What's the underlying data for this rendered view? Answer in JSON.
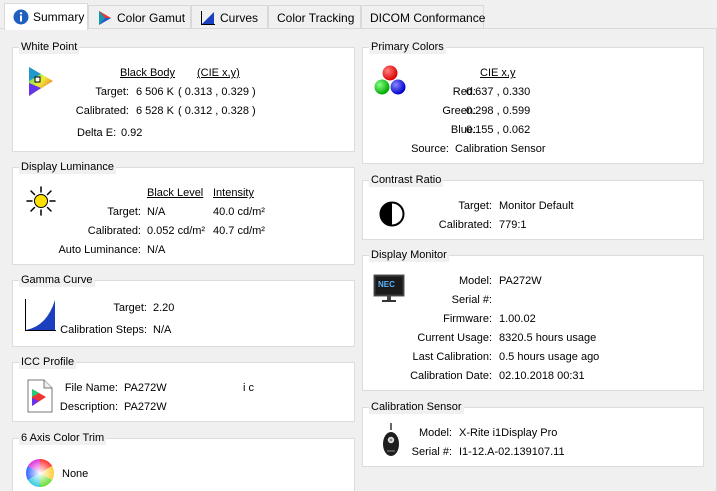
{
  "tabs": [
    {
      "label": "Summary",
      "icon": "info-icon",
      "active": true
    },
    {
      "label": "Color Gamut",
      "icon": "gamut-icon",
      "active": false
    },
    {
      "label": "Curves",
      "icon": "curves-icon",
      "active": false
    },
    {
      "label": "Color Tracking",
      "icon": "",
      "active": false
    },
    {
      "label": "DICOM Conformance",
      "icon": "",
      "active": false
    }
  ],
  "white_point": {
    "title": "White Point",
    "col_black_body": "Black Body",
    "col_cie": "(CIE x,y)",
    "target_label": "Target:",
    "target_value": "6 506 K",
    "target_cie": "( 0.313 , 0.329 )",
    "calibrated_label": "Calibrated:",
    "calibrated_value": "6 528 K",
    "calibrated_cie": "( 0.312 , 0.328 )",
    "delta_label": "Delta E:",
    "delta_value": "0.92"
  },
  "display_luminance": {
    "title": "Display Luminance",
    "col_black": "Black Level",
    "col_intensity": "Intensity",
    "target_label": "Target:",
    "target_black": "N/A",
    "target_intensity": "40.0 cd/m²",
    "calibrated_label": "Calibrated:",
    "calibrated_black": "0.052 cd/m²",
    "calibrated_intensity": "40.7 cd/m²",
    "auto_label": "Auto Luminance:",
    "auto_value": "N/A"
  },
  "gamma_curve": {
    "title": "Gamma Curve",
    "target_label": "Target:",
    "target_value": "2.20",
    "steps_label": "Calibration Steps:",
    "steps_value": "N/A"
  },
  "icc_profile": {
    "title": "ICC Profile",
    "file_label": "File Name:",
    "file_value": "PA272W",
    "file_value_tail": "i c",
    "desc_label": "Description:",
    "desc_value": "PA272W"
  },
  "six_axis": {
    "title": "6 Axis Color Trim",
    "value": "None"
  },
  "primary_colors": {
    "title": "Primary Colors",
    "col_cie": "CIE x,y",
    "red_label": "Red:",
    "red_value": "0.637 , 0.330",
    "green_label": "Green:",
    "green_value": "0.298 , 0.599",
    "blue_label": "Blue:",
    "blue_value": "0.155 , 0.062",
    "source_label": "Source:",
    "source_value": "Calibration Sensor"
  },
  "contrast_ratio": {
    "title": "Contrast Ratio",
    "target_label": "Target:",
    "target_value": "Monitor Default",
    "calibrated_label": "Calibrated:",
    "calibrated_value": "779:1"
  },
  "display_monitor": {
    "title": "Display Monitor",
    "logo_text": "NEC",
    "model_label": "Model:",
    "model_value": "PA272W",
    "serial_label": "Serial #:",
    "firmware_label": "Firmware:",
    "firmware_value": "1.00.02",
    "usage_label": "Current Usage:",
    "usage_value": "8320.5 hours usage",
    "lastcal_label": "Last Calibration:",
    "lastcal_value": "0.5 hours usage ago",
    "caldate_label": "Calibration Date:",
    "caldate_value": "02.10.2018 00:31"
  },
  "calibration_sensor": {
    "title": "Calibration Sensor",
    "model_label": "Model:",
    "model_value": "X-Rite i1Display Pro",
    "serial_label": "Serial #:",
    "serial_value": "I1-12.A-02.139107.11"
  }
}
